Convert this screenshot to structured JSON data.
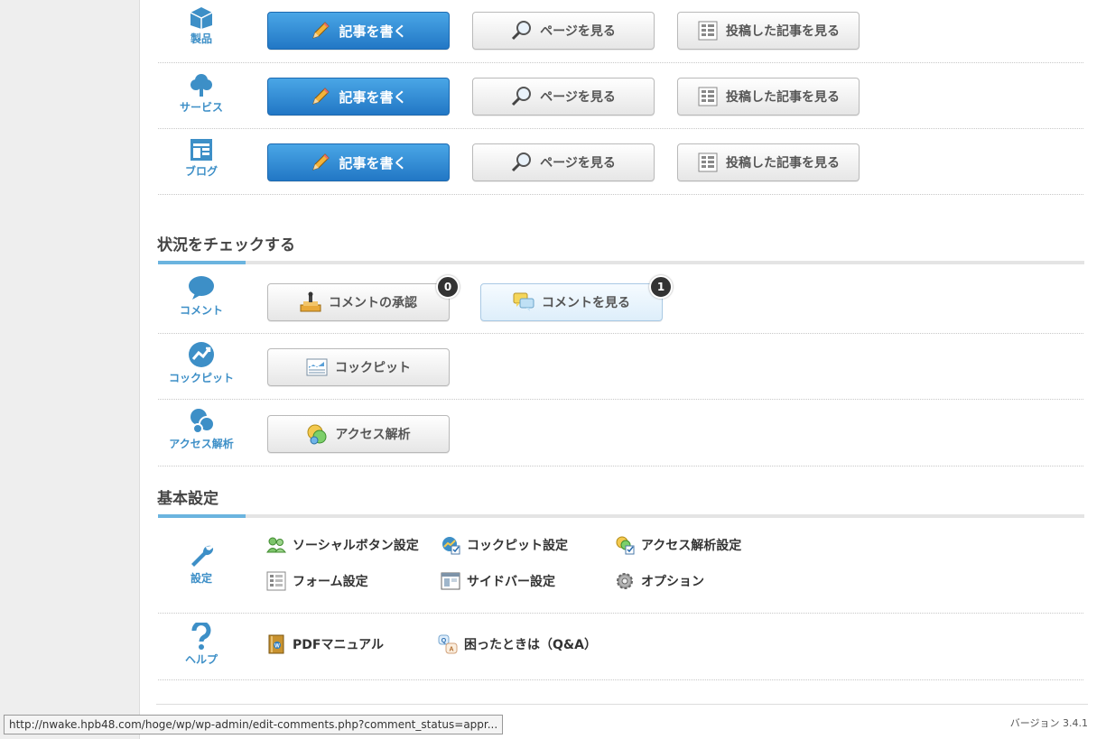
{
  "post_rows": [
    {
      "label": "製品",
      "icon": "box-icon"
    },
    {
      "label": "サービス",
      "icon": "tree-icon"
    },
    {
      "label": "ブログ",
      "icon": "layout-icon"
    }
  ],
  "post_buttons": {
    "write": "記事を書く",
    "view_page": "ページを見る",
    "view_posts": "投稿した記事を見る"
  },
  "status_section": {
    "title": "状況をチェックする",
    "comment_row_label": "コメント",
    "comment_approve": "コメントの承認",
    "comment_approve_count": "0",
    "comment_view": "コメントを見る",
    "comment_view_count": "1",
    "cockpit_row_label": "コックピット",
    "cockpit_button": "コックピット",
    "access_row_label": "アクセス解析",
    "access_button": "アクセス解析"
  },
  "settings_section": {
    "title": "基本設定",
    "row_label": "設定",
    "links": [
      "ソーシャルボタン設定",
      "コックピット設定",
      "アクセス解析設定",
      "フォーム設定",
      "サイドバー設定",
      "オプション"
    ]
  },
  "help_section": {
    "row_label": "ヘルプ",
    "links": [
      "PDFマニュアル",
      "困ったときは（Q&A）"
    ]
  },
  "footer": {
    "version": "バージョン 3.4.1"
  },
  "statusbar": {
    "url": "http://nwake.hpb48.com/hoge/wp/wp-admin/edit-comments.php?comment_status=appr..."
  },
  "colors": {
    "accent_blue": "#2f86cf",
    "icon_blue": "#3d8fc7",
    "section_accent": "#6bb4df"
  }
}
